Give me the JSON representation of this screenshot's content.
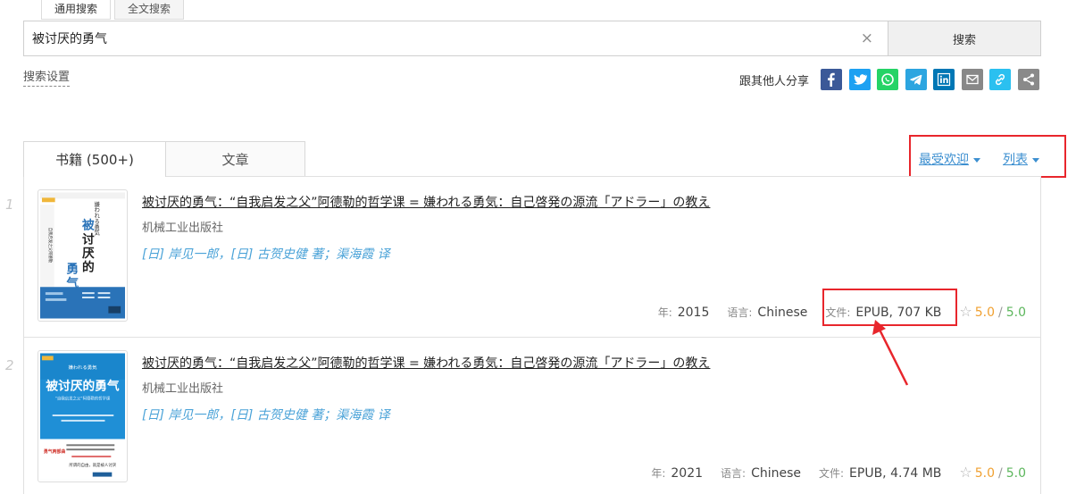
{
  "search_tabs": [
    "通用搜索",
    "全文搜索"
  ],
  "search": {
    "value": "被讨厌的勇气",
    "clear_glyph": "×",
    "button_label": "搜索"
  },
  "settings_link": "搜索设置",
  "share": {
    "label": "跟其他人分享",
    "buttons": [
      {
        "name": "facebook",
        "icon": "facebook-icon",
        "color": "#3b5998"
      },
      {
        "name": "twitter",
        "icon": "twitter-icon",
        "color": "#1da1f2"
      },
      {
        "name": "whatsapp",
        "icon": "whatsapp-icon",
        "color": "#25d366"
      },
      {
        "name": "telegram",
        "icon": "telegram-icon",
        "color": "#2ca5e0"
      },
      {
        "name": "linkedin",
        "icon": "linkedin-icon",
        "color": "#0077b5"
      },
      {
        "name": "email",
        "icon": "mail-icon",
        "color": "#888888"
      },
      {
        "name": "copy-link",
        "icon": "link-icon",
        "color": "#2bc0f0"
      },
      {
        "name": "more",
        "icon": "share-icon",
        "color": "#8a8a8a"
      }
    ]
  },
  "result_tabs": {
    "books": "书籍 (500+)",
    "articles": "文章"
  },
  "sort": {
    "order": "最受欢迎",
    "view": "列表"
  },
  "results": [
    {
      "index": "1",
      "title": "被讨厌的勇气：“自我启发之父”阿德勒的哲学课 = 嫌われる勇気：自己啓発の源流「アドラー」の教え",
      "publisher": "机械工业出版社",
      "authors": "[日] 岸见一郎，[日] 古贺史健 著；渠海霞 译",
      "year_label": "年:",
      "year": "2015",
      "lang_label": "语言:",
      "language": "Chinese",
      "file_label": "文件:",
      "file": "EPUB, 707 KB",
      "rating": "5.0",
      "rating_max": "5.0",
      "cover": {
        "top": "嫌われる勇気",
        "title": [
          "被",
          "讨",
          "厌",
          "的",
          "勇",
          "气"
        ],
        "colors": [
          "#ffffff",
          "#2a73b8"
        ]
      }
    },
    {
      "index": "2",
      "title": "被讨厌的勇气：“自我启发之父”阿德勒的哲学课 = 嫌われる勇気：自己啓発の源流「アドラー」の教え",
      "publisher": "机械工业出版社",
      "authors": "[日] 岸见一郎，[日] 古贺史健 著；渠海霞 译",
      "year_label": "年:",
      "year": "2021",
      "lang_label": "语言:",
      "language": "Chinese",
      "file_label": "文件:",
      "file": "EPUB, 4.74 MB",
      "rating": "5.0",
      "rating_max": "5.0",
      "cover": {
        "top": "嫌われる勇気",
        "title": [
          "被讨厌的勇气"
        ],
        "subtitle": "“自我启发之父”阿德勒的哲学课",
        "badge": "勇气两部曲",
        "bottom": "所谓的自由，就是被人讨厌",
        "colors": [
          "#1f8fd6",
          "#ffffff"
        ]
      }
    }
  ],
  "annotation_colors": {
    "highlight": "#e8262c"
  }
}
